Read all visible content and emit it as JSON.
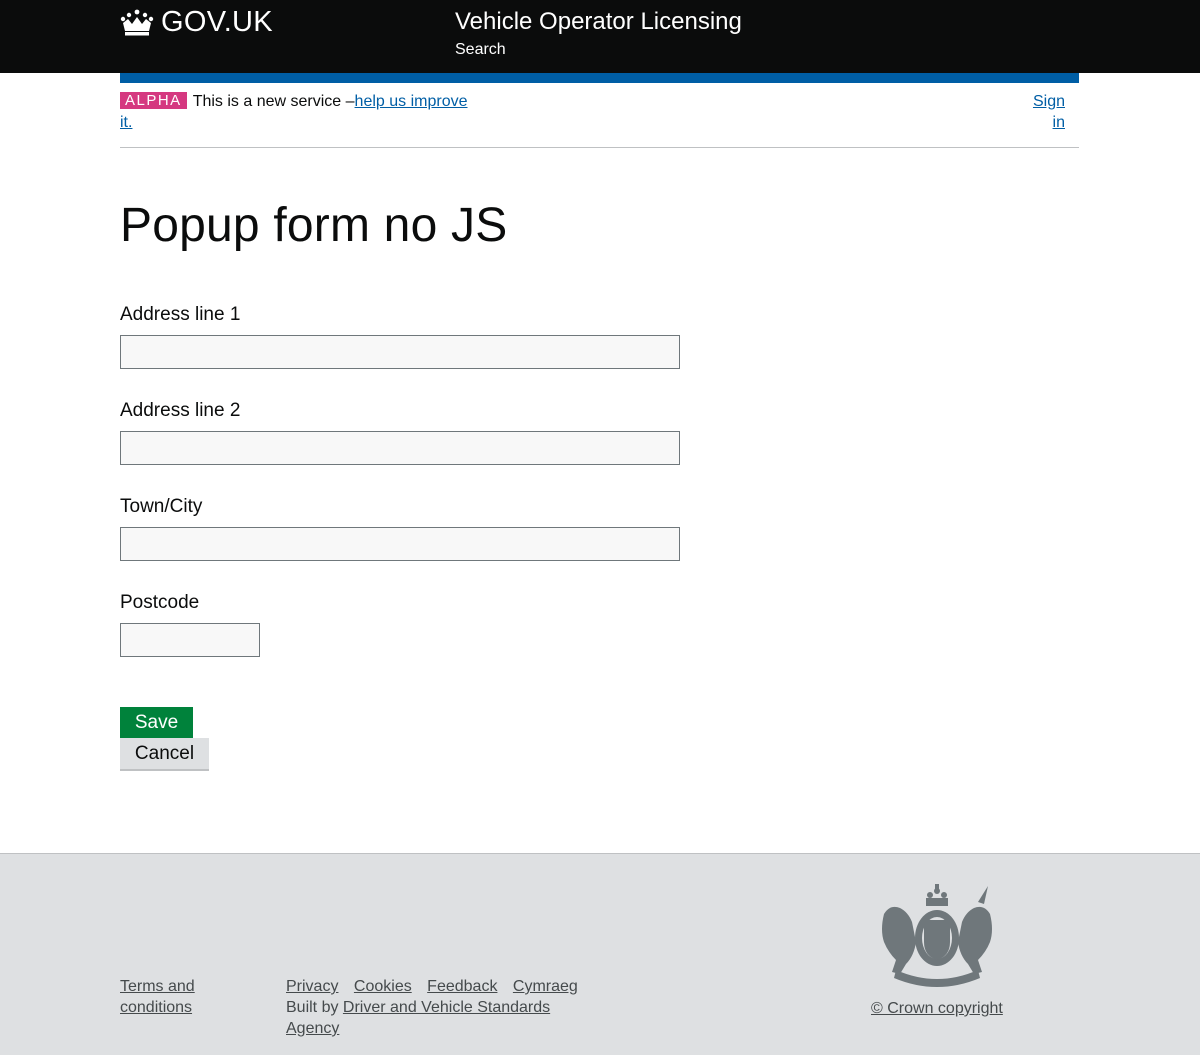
{
  "header": {
    "logo_text": "GOV.UK",
    "service_name": "Vehicle Operator Licensing",
    "nav_search": "Search"
  },
  "phase_banner": {
    "tag": "ALPHA",
    "text": "This is a new service –",
    "link_text": "help us improve it.",
    "sign_in": "Sign in"
  },
  "page": {
    "title": "Popup form no JS"
  },
  "form": {
    "fields": [
      {
        "label": "Address line 1",
        "value": ""
      },
      {
        "label": "Address line 2",
        "value": ""
      },
      {
        "label": "Town/City",
        "value": ""
      },
      {
        "label": "Postcode",
        "value": ""
      }
    ],
    "save_label": "Save",
    "cancel_label": "Cancel"
  },
  "footer": {
    "terms": "Terms and conditions",
    "links": [
      "Privacy",
      "Cookies",
      "Feedback",
      "Cymraeg"
    ],
    "built_by_prefix": "Built by ",
    "built_by_link": "Driver and Vehicle Standards Agency",
    "copyright": "© Crown copyright"
  },
  "colors": {
    "header_bg": "#0b0c0c",
    "accent_blue": "#005ea5",
    "alpha_tag": "#d53880",
    "save_button": "#00823b",
    "footer_bg": "#dee0e2"
  }
}
